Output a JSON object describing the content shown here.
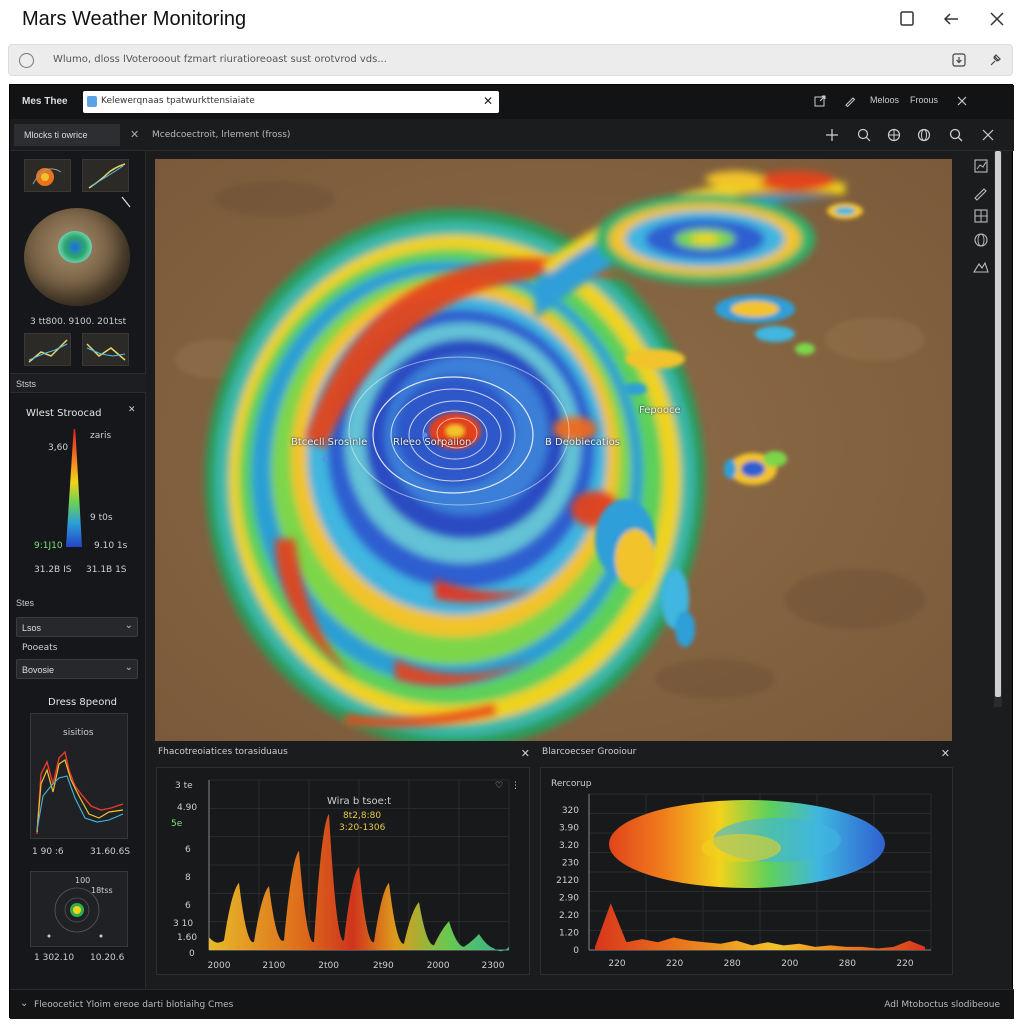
{
  "window": {
    "title": "Mars Weather Monitoring",
    "restore_icon": "square-icon",
    "back_icon": "arrow-left-icon",
    "close_icon": "close-icon"
  },
  "address_bar": {
    "url": "Wlumo, dloss lVoterooout fzmart riuratioreoast sust orotvrod vds..."
  },
  "app": {
    "brand": "Mes Thee",
    "search_value": "Kelewerqnaas tpatwurkttensiaiate",
    "top_items": [
      "Meloos",
      "Froous"
    ],
    "toolbar_tab": "Mlocks ti owrice",
    "toolbar_layer": "Mcedcoectroit, lrlement (fross)"
  },
  "sidebar": {
    "coords": "3 tt800. 9100. 201tst",
    "section_stats": "Ststs",
    "wind_title": "Wlest Stroocad",
    "spec_top_left": "3,60",
    "spec_top_right": "zaris",
    "spec_mid_right": "9 t0s",
    "spec_left_green": "9:1J10",
    "spec_right": "9.10 1s",
    "spec_bottom_left": "31.2B IS",
    "spec_bottom_right": "31.1B 1S",
    "section_sites": "Stes",
    "select1": "Lsos",
    "sites_label": "Pooeats",
    "select2": "Bovosie",
    "dress_label": "Dress 8peond",
    "mini_title": "sisitios",
    "mini_left": "1 90 :6",
    "mini_right": "31.60.6S",
    "radar_top": "100",
    "radar_sub": "18tss",
    "radar_left": "1 302.10",
    "radar_right": "10.20.6"
  },
  "map": {
    "label_left": "Btcecll Srosinle",
    "label_center": "Rleeo Sorpaiion",
    "label_right": "B Deobiecatios",
    "label_far_right": "Fepooce"
  },
  "bottom_left": {
    "header": "Fhacotreoiatices torasiduaus",
    "chart_title": "Wira b tsoe:t",
    "chart_sub1": "8t2,8:80",
    "chart_sub2": "3:20-1306",
    "y_top": "3 te",
    "y_label2": "4.90",
    "y_label_green": "5e",
    "y_label3": "6",
    "y_label4": "8",
    "y_label5": "6",
    "y_label6": "3 10",
    "y_label7": "1.60",
    "y_zero": "0",
    "x_ticks": [
      "2000",
      "2100",
      "2t00",
      "2t90",
      "2000",
      "2300"
    ]
  },
  "bottom_right": {
    "header": "Blarcoecser Grooiour",
    "corner_label": "Rercorup",
    "y_ticks": [
      "320",
      "3.90",
      "3.20",
      "230",
      "2120",
      "2.90",
      "2.20",
      "1.20",
      "0"
    ],
    "x_ticks": [
      "220",
      "220",
      "280",
      "200",
      "280",
      "220"
    ]
  },
  "status": {
    "left": "Fleoocetict Yloim ereoe darti blotiaihg Cmes",
    "right": "Adl Mtoboctus slodibeoue"
  },
  "chart_data": [
    {
      "type": "area",
      "title": "Wira b tsoe:t",
      "x_tick_labels": [
        "2000",
        "2100",
        "2t00",
        "2t90",
        "2000",
        "2300"
      ],
      "y_tick_labels": [
        "3 te",
        "4.90",
        "6",
        "8",
        "6",
        "3 10",
        "1.60",
        "0"
      ],
      "series": [
        {
          "values": [
            0.08,
            0.06,
            0.42,
            0.05,
            0.4,
            0.06,
            0.62,
            0.05,
            0.85,
            0.06,
            0.52,
            0.05,
            0.42,
            0.04,
            0.3,
            0.03,
            0.18,
            0.02,
            0.1,
            0.01,
            0.02
          ]
        }
      ]
    },
    {
      "type": "area",
      "title": "",
      "x_tick_labels": [
        "220",
        "220",
        "280",
        "200",
        "280",
        "220"
      ],
      "y_tick_labels": [
        "320",
        "3.90",
        "3.20",
        "230",
        "2120",
        "2.90",
        "2.20",
        "1.20",
        "0"
      ],
      "series": [
        {
          "values": [
            0.02,
            0.3,
            0.05,
            0.07,
            0.05,
            0.08,
            0.06,
            0.05,
            0.04,
            0.06,
            0.03,
            0.05,
            0.03,
            0.04,
            0.02,
            0.03,
            0.02,
            0.02,
            0.01,
            0.02,
            0.06,
            0.02
          ]
        }
      ]
    }
  ]
}
